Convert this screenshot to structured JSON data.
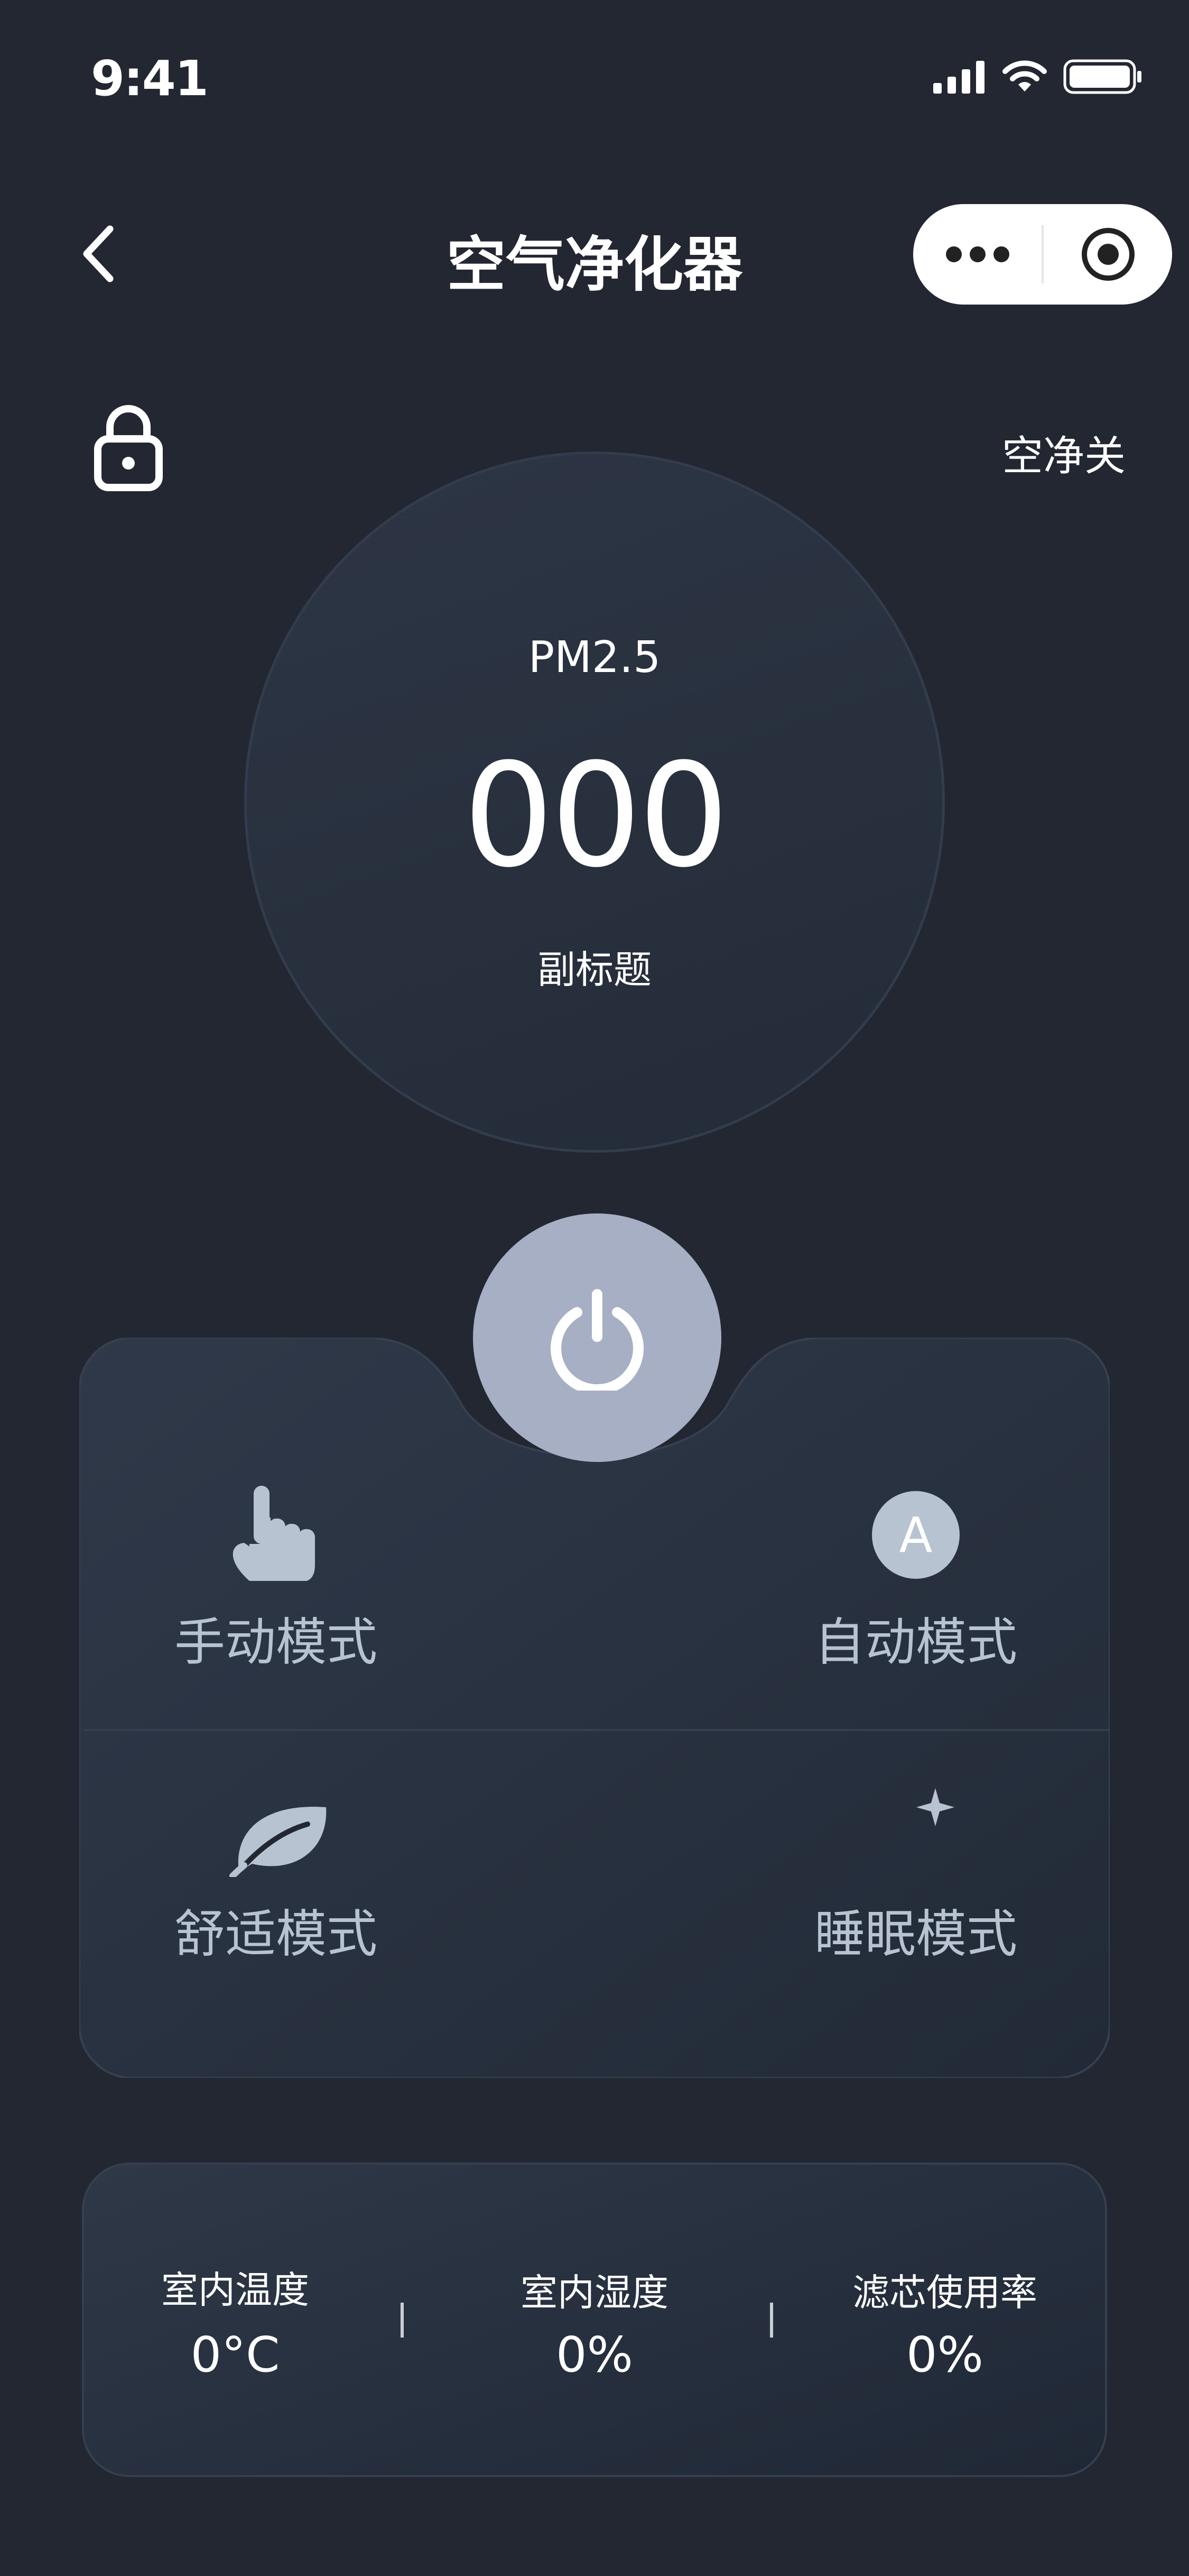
{
  "status_bar": {
    "time": "9:41"
  },
  "nav": {
    "title": "空气净化器"
  },
  "device": {
    "purifier_status": "空净关"
  },
  "pm": {
    "label": "PM2.5",
    "value": "000",
    "subtitle": "副标题"
  },
  "modes": [
    {
      "label": "手动模式",
      "icon": "hand-pointer-icon"
    },
    {
      "label": "自动模式",
      "icon": "auto-a-icon",
      "icon_letter": "A"
    },
    {
      "label": "舒适模式",
      "icon": "leaf-icon"
    },
    {
      "label": "睡眠模式",
      "icon": "moon-star-icon"
    }
  ],
  "stats": [
    {
      "title": "室内温度",
      "value": "0°C"
    },
    {
      "title": "室内湿度",
      "value": "0%"
    },
    {
      "title": "滤芯使用率",
      "value": "0%"
    }
  ],
  "colors": {
    "background": "#232732",
    "power_button": "#a6afc4",
    "mode_label": "#b8c3d1",
    "icon_fill": "#b8c3d1"
  }
}
